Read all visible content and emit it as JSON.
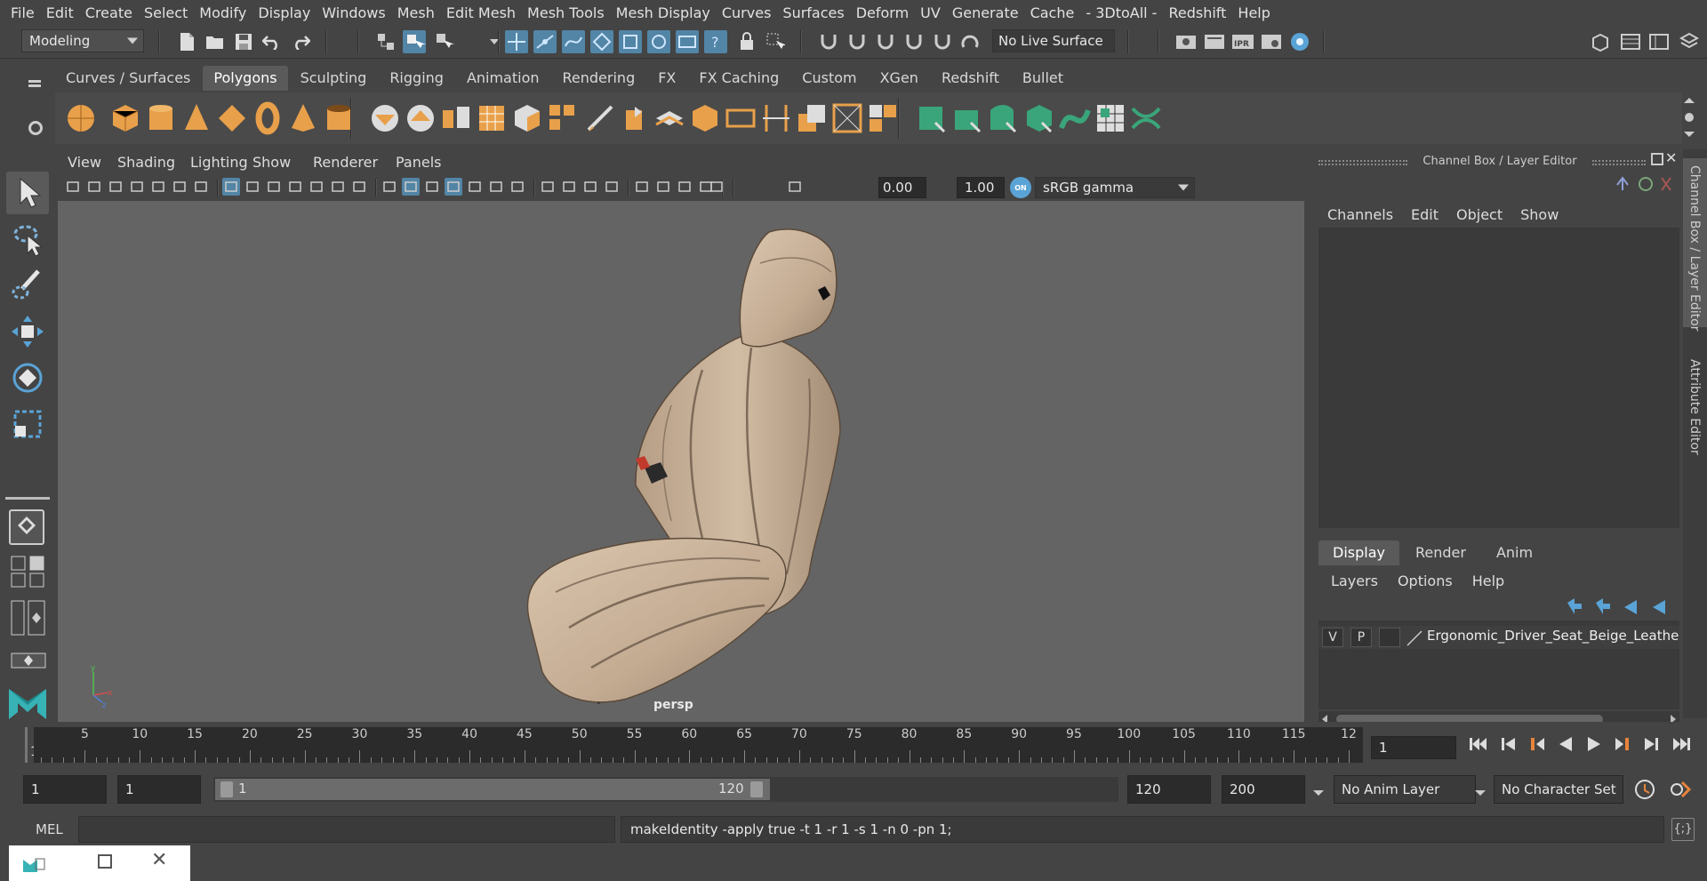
{
  "menubar": {
    "items": [
      "File",
      "Edit",
      "Create",
      "Select",
      "Modify",
      "Display",
      "Windows",
      "Mesh",
      "Edit Mesh",
      "Mesh Tools",
      "Mesh Display",
      "Curves",
      "Surfaces",
      "Deform",
      "UV",
      "Generate",
      "Cache",
      "- 3DtoAll -",
      "Redshift",
      "Help"
    ]
  },
  "status": {
    "mode": "Modeling",
    "live_surface": "No Live Surface"
  },
  "shelf": {
    "tabs": [
      "Curves / Surfaces",
      "Polygons",
      "Sculpting",
      "Rigging",
      "Animation",
      "Rendering",
      "FX",
      "FX Caching",
      "Custom",
      "XGen",
      "Redshift",
      "Bullet"
    ],
    "active_tab": "Polygons"
  },
  "viewport": {
    "menu": [
      "View",
      "Shading",
      "Lighting",
      "Show",
      "Renderer",
      "Panels"
    ],
    "exposure": "0.00",
    "gamma": "1.00",
    "color_space": "sRGB gamma",
    "camera_label": "persp"
  },
  "channel_box": {
    "title": "Channel Box / Layer Editor",
    "menu": [
      "Channels",
      "Edit",
      "Object",
      "Show"
    ]
  },
  "layer_editor": {
    "tabs": [
      "Display",
      "Render",
      "Anim"
    ],
    "active_tab": "Display",
    "menu": [
      "Layers",
      "Options",
      "Help"
    ],
    "layer": {
      "v": "V",
      "p": "P",
      "name": "Ergonomic_Driver_Seat_Beige_Leathe"
    }
  },
  "side_tabs": [
    "Channel Box / Layer Editor",
    "Attribute Editor"
  ],
  "timeline": {
    "ticks": [
      "5",
      "10",
      "15",
      "20",
      "25",
      "30",
      "35",
      "40",
      "45",
      "50",
      "55",
      "60",
      "65",
      "70",
      "75",
      "80",
      "85",
      "90",
      "95",
      "100",
      "105",
      "110",
      "115",
      "12"
    ],
    "first_frame_label": "1",
    "current_frame": "1"
  },
  "range": {
    "start": "1",
    "playback_start": "1",
    "slider_start": "1",
    "slider_end": "120",
    "playback_end": "120",
    "end": "200",
    "anim_layer": "No Anim Layer",
    "character_set": "No Character Set"
  },
  "command": {
    "language": "MEL",
    "result": "makeIdentity -apply true -t 1 -r 1 -s 1 -n 0 -pn 1;"
  },
  "colors": {
    "accent_blue": "#5285a6",
    "shelf_orange": "#e8a04a",
    "shelf_teal": "#3aa57a",
    "seat_beige": "#c9b29a",
    "seat_black": "#1f2124"
  }
}
